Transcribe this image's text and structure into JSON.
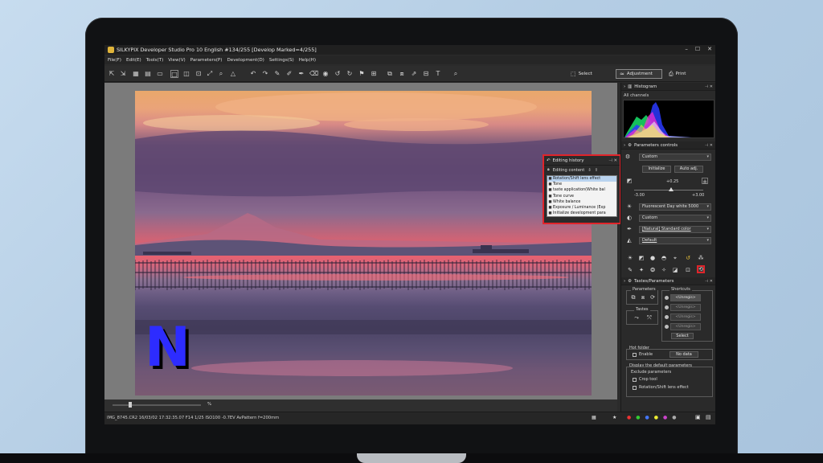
{
  "window": {
    "title": "SILKYPIX Developer Studio Pro 10 English  #134/255 [Develop Marked=4/255]",
    "controls": [
      "–",
      "☐",
      "✕"
    ]
  },
  "menu": [
    "File(F)",
    "Edit(E)",
    "Tools(T)",
    "View(V)",
    "Parameters(P)",
    "Development(D)",
    "Settings(S)",
    "Help(H)"
  ],
  "toolbar": {
    "modes": [
      {
        "label": "Select",
        "icon": "⬚"
      },
      {
        "label": "Adjustment",
        "icon": "≈"
      },
      {
        "label": "Print",
        "icon": "⎙"
      }
    ]
  },
  "overlay": {
    "logo_letter": "N"
  },
  "history": {
    "title": "Editing history",
    "subtitle": "Editing content",
    "items": [
      {
        "label": "Rotation/Shift lens effect",
        "selected": true
      },
      {
        "label": "Tone",
        "selected": false
      },
      {
        "label": "taste application(White bal",
        "selected": false
      },
      {
        "label": "Tone curve",
        "selected": false
      },
      {
        "label": "White balance",
        "selected": false
      },
      {
        "label": "Exposure / Luminance (Exp",
        "selected": false
      },
      {
        "label": "Initialize development para",
        "selected": false
      }
    ]
  },
  "viewer": {
    "zoom_label": "%"
  },
  "status": {
    "info": "IMG_8745.CR2 16/03/02 17:32:35.07 F14 1/25 ISO100 -0.7EV AvPattern f=200mm"
  },
  "panel": {
    "histogram": {
      "title": "Histogram",
      "channel": "All channels"
    },
    "parameters": {
      "title": "Parameters controls",
      "preset": "Custom",
      "initialize": "Initialize",
      "auto_adj": "Auto adj.",
      "exposure_value": "+0.25",
      "range_min": "-3.00",
      "range_max": "+3.00",
      "white_balance": "Fluorescent Day white 5000",
      "tone": "Custom",
      "color": "[Natural] Standard color",
      "sharpness": "Default"
    },
    "taste": {
      "title": "Tastes/Parameters",
      "parameters_label": "Parameters",
      "tastes_label": "Tastes",
      "shortcuts_label": "Shortcuts",
      "shortcut_items": [
        "<Unregis>",
        "<Unregis>",
        "<Unregis>",
        "<Unregis>"
      ],
      "select": "Select"
    },
    "hot_folder": {
      "title": "Hot folder",
      "enable": "Enable",
      "no_data": "No data"
    },
    "defaults": {
      "title": "Display the default parameters",
      "exclude": "Exclude parameters",
      "crop": "Crop tool",
      "rotation": "Rotation/Shift lens effect"
    }
  },
  "colors": {
    "highlight": "#e0242a",
    "selection": "#b9d3ef",
    "accent_logo": "#2d2cff"
  }
}
